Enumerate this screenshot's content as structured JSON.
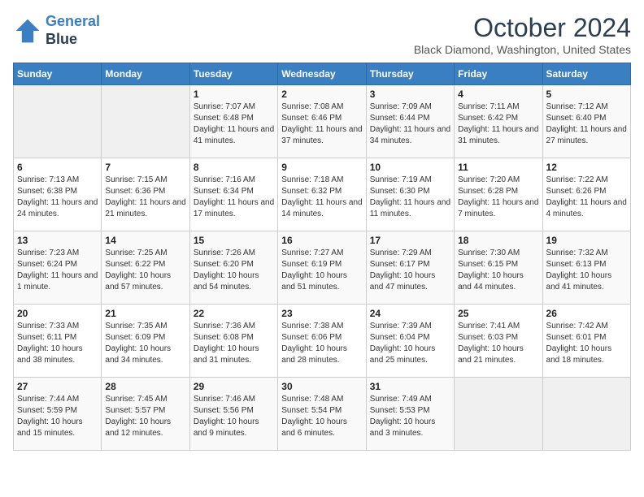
{
  "header": {
    "logo_line1": "General",
    "logo_line2": "Blue",
    "month_title": "October 2024",
    "location": "Black Diamond, Washington, United States"
  },
  "days_of_week": [
    "Sunday",
    "Monday",
    "Tuesday",
    "Wednesday",
    "Thursday",
    "Friday",
    "Saturday"
  ],
  "weeks": [
    [
      {
        "day": "",
        "info": ""
      },
      {
        "day": "",
        "info": ""
      },
      {
        "day": "1",
        "info": "Sunrise: 7:07 AM\nSunset: 6:48 PM\nDaylight: 11 hours and 41 minutes."
      },
      {
        "day": "2",
        "info": "Sunrise: 7:08 AM\nSunset: 6:46 PM\nDaylight: 11 hours and 37 minutes."
      },
      {
        "day": "3",
        "info": "Sunrise: 7:09 AM\nSunset: 6:44 PM\nDaylight: 11 hours and 34 minutes."
      },
      {
        "day": "4",
        "info": "Sunrise: 7:11 AM\nSunset: 6:42 PM\nDaylight: 11 hours and 31 minutes."
      },
      {
        "day": "5",
        "info": "Sunrise: 7:12 AM\nSunset: 6:40 PM\nDaylight: 11 hours and 27 minutes."
      }
    ],
    [
      {
        "day": "6",
        "info": "Sunrise: 7:13 AM\nSunset: 6:38 PM\nDaylight: 11 hours and 24 minutes."
      },
      {
        "day": "7",
        "info": "Sunrise: 7:15 AM\nSunset: 6:36 PM\nDaylight: 11 hours and 21 minutes."
      },
      {
        "day": "8",
        "info": "Sunrise: 7:16 AM\nSunset: 6:34 PM\nDaylight: 11 hours and 17 minutes."
      },
      {
        "day": "9",
        "info": "Sunrise: 7:18 AM\nSunset: 6:32 PM\nDaylight: 11 hours and 14 minutes."
      },
      {
        "day": "10",
        "info": "Sunrise: 7:19 AM\nSunset: 6:30 PM\nDaylight: 11 hours and 11 minutes."
      },
      {
        "day": "11",
        "info": "Sunrise: 7:20 AM\nSunset: 6:28 PM\nDaylight: 11 hours and 7 minutes."
      },
      {
        "day": "12",
        "info": "Sunrise: 7:22 AM\nSunset: 6:26 PM\nDaylight: 11 hours and 4 minutes."
      }
    ],
    [
      {
        "day": "13",
        "info": "Sunrise: 7:23 AM\nSunset: 6:24 PM\nDaylight: 11 hours and 1 minute."
      },
      {
        "day": "14",
        "info": "Sunrise: 7:25 AM\nSunset: 6:22 PM\nDaylight: 10 hours and 57 minutes."
      },
      {
        "day": "15",
        "info": "Sunrise: 7:26 AM\nSunset: 6:20 PM\nDaylight: 10 hours and 54 minutes."
      },
      {
        "day": "16",
        "info": "Sunrise: 7:27 AM\nSunset: 6:19 PM\nDaylight: 10 hours and 51 minutes."
      },
      {
        "day": "17",
        "info": "Sunrise: 7:29 AM\nSunset: 6:17 PM\nDaylight: 10 hours and 47 minutes."
      },
      {
        "day": "18",
        "info": "Sunrise: 7:30 AM\nSunset: 6:15 PM\nDaylight: 10 hours and 44 minutes."
      },
      {
        "day": "19",
        "info": "Sunrise: 7:32 AM\nSunset: 6:13 PM\nDaylight: 10 hours and 41 minutes."
      }
    ],
    [
      {
        "day": "20",
        "info": "Sunrise: 7:33 AM\nSunset: 6:11 PM\nDaylight: 10 hours and 38 minutes."
      },
      {
        "day": "21",
        "info": "Sunrise: 7:35 AM\nSunset: 6:09 PM\nDaylight: 10 hours and 34 minutes."
      },
      {
        "day": "22",
        "info": "Sunrise: 7:36 AM\nSunset: 6:08 PM\nDaylight: 10 hours and 31 minutes."
      },
      {
        "day": "23",
        "info": "Sunrise: 7:38 AM\nSunset: 6:06 PM\nDaylight: 10 hours and 28 minutes."
      },
      {
        "day": "24",
        "info": "Sunrise: 7:39 AM\nSunset: 6:04 PM\nDaylight: 10 hours and 25 minutes."
      },
      {
        "day": "25",
        "info": "Sunrise: 7:41 AM\nSunset: 6:03 PM\nDaylight: 10 hours and 21 minutes."
      },
      {
        "day": "26",
        "info": "Sunrise: 7:42 AM\nSunset: 6:01 PM\nDaylight: 10 hours and 18 minutes."
      }
    ],
    [
      {
        "day": "27",
        "info": "Sunrise: 7:44 AM\nSunset: 5:59 PM\nDaylight: 10 hours and 15 minutes."
      },
      {
        "day": "28",
        "info": "Sunrise: 7:45 AM\nSunset: 5:57 PM\nDaylight: 10 hours and 12 minutes."
      },
      {
        "day": "29",
        "info": "Sunrise: 7:46 AM\nSunset: 5:56 PM\nDaylight: 10 hours and 9 minutes."
      },
      {
        "day": "30",
        "info": "Sunrise: 7:48 AM\nSunset: 5:54 PM\nDaylight: 10 hours and 6 minutes."
      },
      {
        "day": "31",
        "info": "Sunrise: 7:49 AM\nSunset: 5:53 PM\nDaylight: 10 hours and 3 minutes."
      },
      {
        "day": "",
        "info": ""
      },
      {
        "day": "",
        "info": ""
      }
    ]
  ]
}
